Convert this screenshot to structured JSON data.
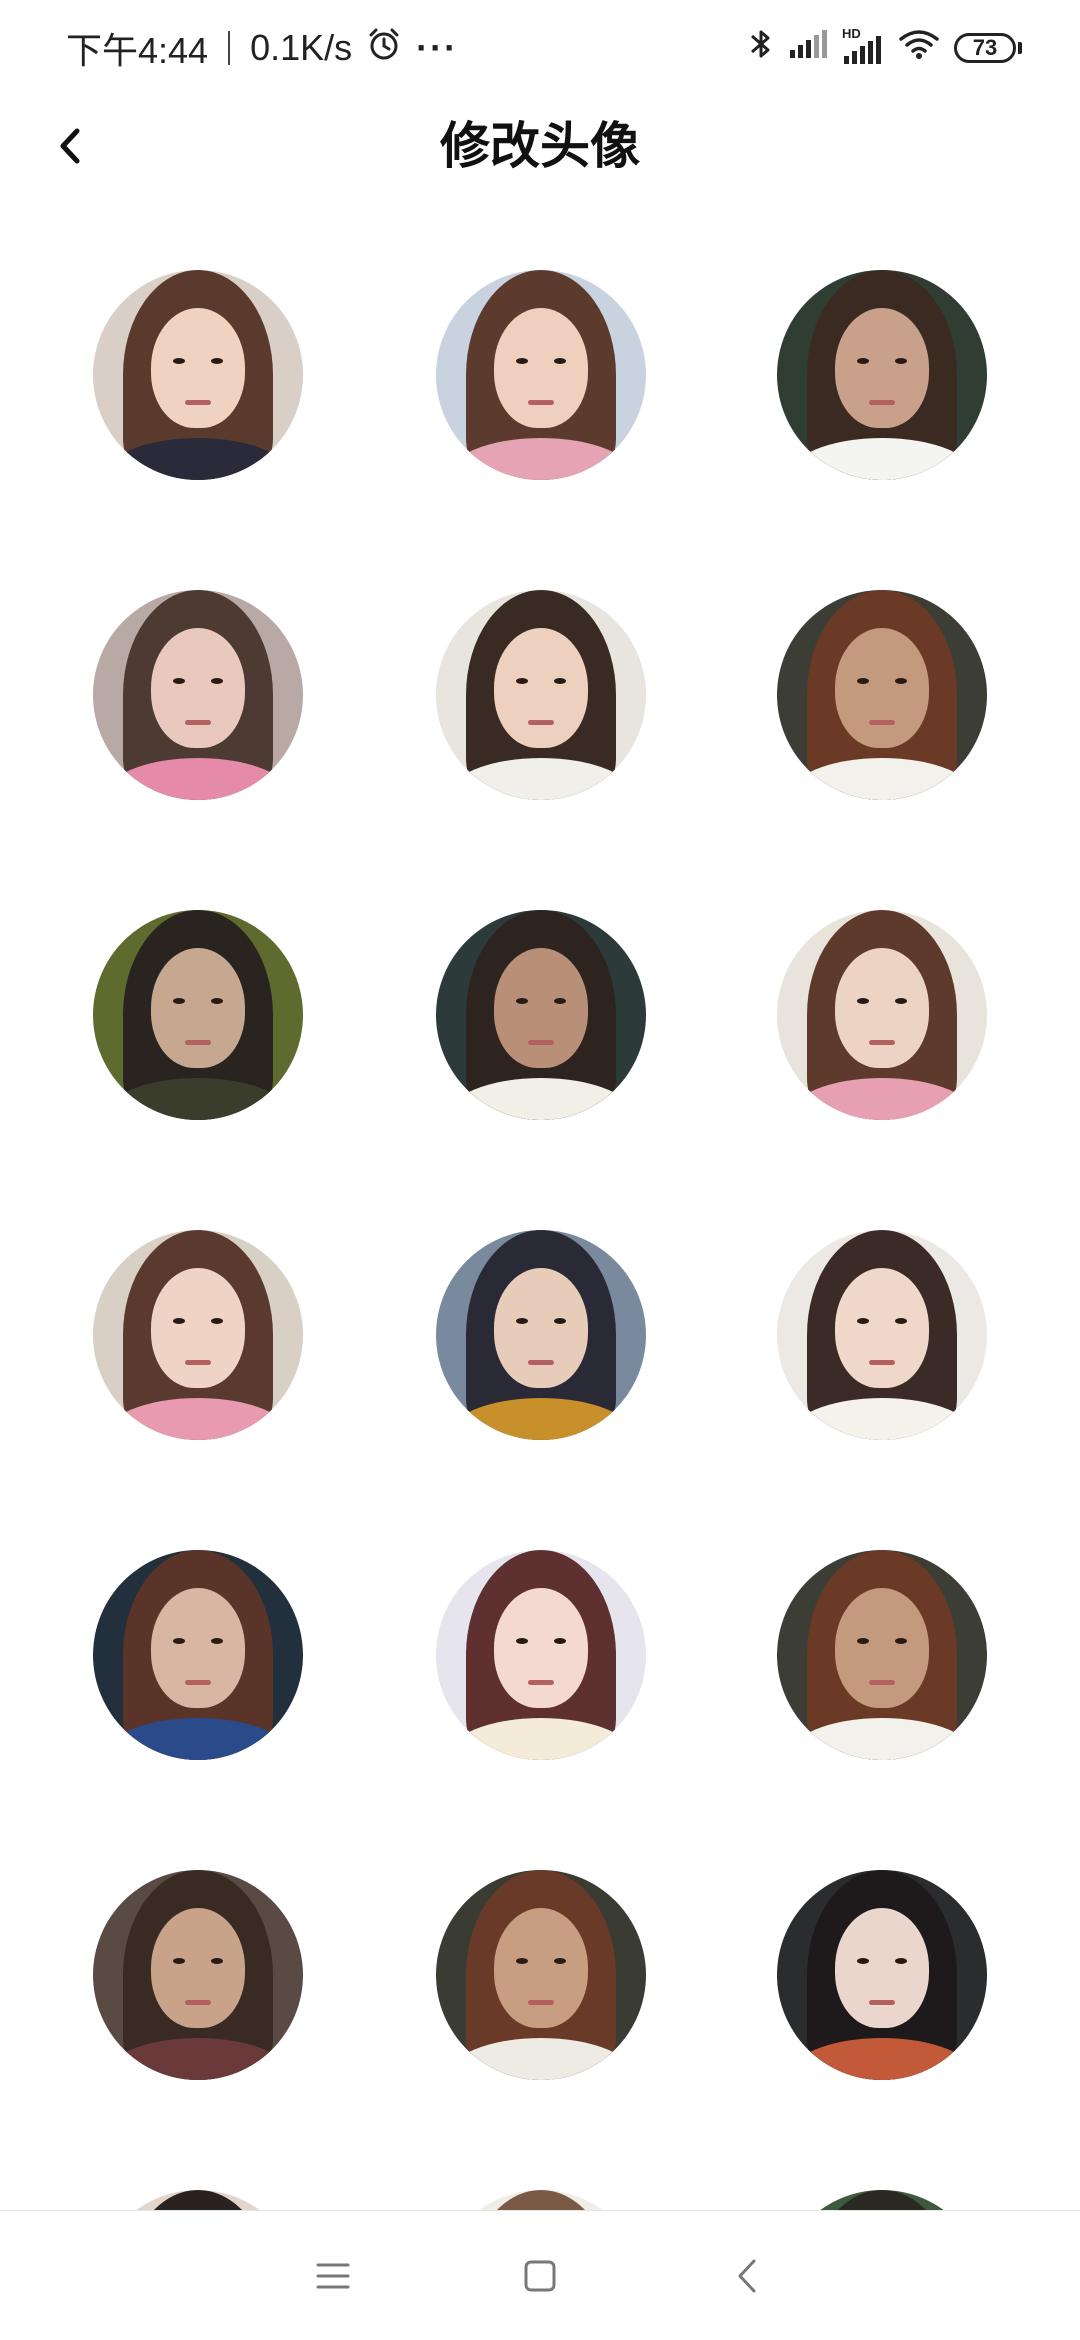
{
  "status_bar": {
    "time": "下午4:44",
    "net_speed": "0.1K/s",
    "more": "···",
    "hd_label": "HD",
    "battery": "73",
    "icons": [
      "alarm-icon",
      "bluetooth-icon",
      "signal-icon",
      "hd-signal-icon",
      "wifi-icon",
      "battery-icon"
    ]
  },
  "header": {
    "title": "修改头像",
    "back_icon": "chevron-left-icon"
  },
  "avatars": [
    {
      "hair": "#5a3a2c",
      "skin": "#f0d2c0",
      "bg": "#d9cfc6",
      "cloth": "#2a2a3a"
    },
    {
      "hair": "#5c3b2e",
      "skin": "#efd0be",
      "bg": "#c9d2df",
      "cloth": "#e6a3b4"
    },
    {
      "hair": "#3a2a22",
      "skin": "#c9a08a",
      "bg": "#2f3d33",
      "cloth": "#f4f4f0"
    },
    {
      "hair": "#4c3a33",
      "skin": "#e9c8bd",
      "bg": "#b9a9a4",
      "cloth": "#e58aa8"
    },
    {
      "hair": "#3a2a24",
      "skin": "#edd0bd",
      "bg": "#e8e4de",
      "cloth": "#f0efe9"
    },
    {
      "hair": "#6a3a26",
      "skin": "#c49a7e",
      "bg": "#3c3e36",
      "cloth": "#f2f1ec"
    },
    {
      "hair": "#2a2420",
      "skin": "#c6a890",
      "bg": "#5f6b2e",
      "cloth": "#3b3d2c"
    },
    {
      "hair": "#2d2420",
      "skin": "#b89078",
      "bg": "#2c3a3a",
      "cloth": "#f1efe6"
    },
    {
      "hair": "#5e3a2c",
      "skin": "#edd3c3",
      "bg": "#e8e4dc",
      "cloth": "#e6a0b2"
    },
    {
      "hair": "#5a3a2e",
      "skin": "#efd4c6",
      "bg": "#d8d0c4",
      "cloth": "#e79ab0"
    },
    {
      "hair": "#2a2a36",
      "skin": "#e8ccba",
      "bg": "#7a8a9e",
      "cloth": "#c8902a"
    },
    {
      "hair": "#3c2a26",
      "skin": "#efd8ca",
      "bg": "#ece8e4",
      "cloth": "#f4f2ea"
    },
    {
      "hair": "#5a3428",
      "skin": "#d9b6a4",
      "bg": "#22303e",
      "cloth": "#2a4a8a"
    },
    {
      "hair": "#5e3030",
      "skin": "#f4d8d2",
      "bg": "#e6e4ec",
      "cloth": "#f4ecd8"
    },
    {
      "hair": "#6a3a26",
      "skin": "#c49a7e",
      "bg": "#3c3e36",
      "cloth": "#f2f1ec"
    },
    {
      "hair": "#3a2a24",
      "skin": "#c9a28a",
      "bg": "#5a4a44",
      "cloth": "#6a3a3a"
    },
    {
      "hair": "#6a3a28",
      "skin": "#c89e82",
      "bg": "#3a3c34",
      "cloth": "#eeeae4"
    },
    {
      "hair": "#1e1a1c",
      "skin": "#ead6cc",
      "bg": "#2a2c2e",
      "cloth": "#c25a3a"
    },
    {
      "hair": "#2a221e",
      "skin": "#d9b8a2",
      "bg": "#e2d6cc",
      "cloth": "#3a3a3a"
    },
    {
      "hair": "#7a5a44",
      "skin": "#e8cdb8",
      "bg": "#f0ece6",
      "cloth": "#e0d2c4"
    },
    {
      "hair": "#2a2a22",
      "skin": "#ccab92",
      "bg": "#3e5a3e",
      "cloth": "#d4d0c4"
    }
  ],
  "nav_bar": {
    "icons": [
      "menu-icon",
      "home-square-icon",
      "back-triangle-icon"
    ]
  }
}
